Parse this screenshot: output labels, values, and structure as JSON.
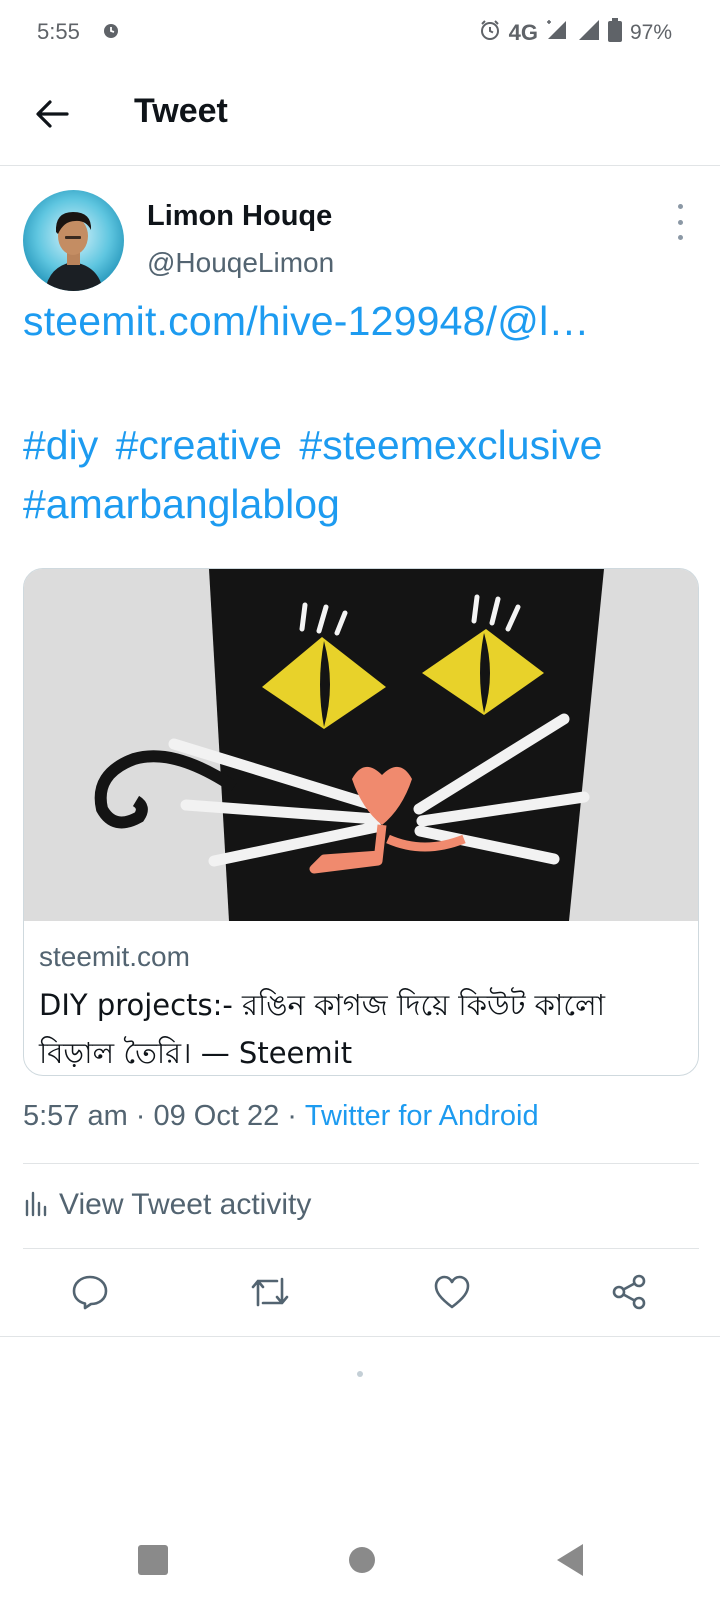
{
  "status_bar": {
    "time": "5:55",
    "network": "4G",
    "battery": "97%",
    "icons": [
      "alarm-icon",
      "alarm-icon",
      "signal-icon",
      "signal-icon",
      "battery-icon"
    ]
  },
  "topbar": {
    "title": "Tweet",
    "back_icon": "arrow-left-icon"
  },
  "tweet": {
    "author_name": "Limon Houqe",
    "author_handle": "@HouqeLimon",
    "link_text": "steemit.com/hive-129948/@l…",
    "hashtags": [
      "#diy",
      "#creative",
      "#steemexclusive",
      "#amarbanglablog"
    ],
    "card": {
      "domain": "steemit.com",
      "title": "DIY projects:- রঙিন কাগজ দিয়ে কিউট কালো বিড়াল তৈরি। — Steemit"
    },
    "meta": {
      "time": "5:57 am",
      "date": "09 Oct 22",
      "separator": "·",
      "source": "Twitter for Android"
    },
    "activity_label": "View Tweet activity",
    "actions": [
      "reply-icon",
      "retweet-icon",
      "like-icon",
      "share-icon"
    ]
  },
  "colors": {
    "accent": "#1d9bf0",
    "text_primary": "#0f1419",
    "text_secondary": "#536471",
    "divider": "#e1e4e6"
  }
}
